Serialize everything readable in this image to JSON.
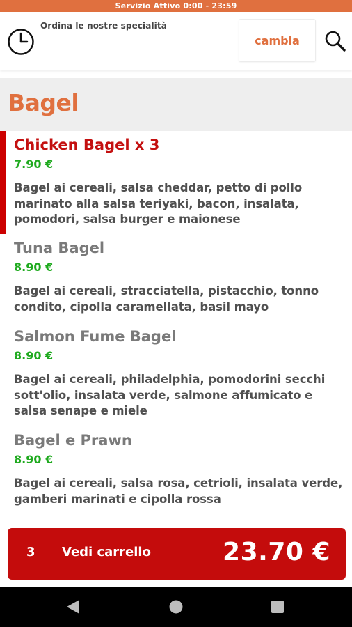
{
  "status_bar": {
    "text": "Servizio Attivo  0:00 - 23:59"
  },
  "header": {
    "order_text": "Ordina le nostre specialità",
    "change_label": "cambia"
  },
  "section": {
    "title": "Bagel"
  },
  "products": [
    {
      "name": "Chicken Bagel x 3",
      "price": "7.90 €",
      "description": "Bagel ai cereali, salsa cheddar, petto di pollo marinato alla salsa teriyaki, bacon, insalata, pomodori, salsa burger e maionese"
    },
    {
      "name": "Tuna Bagel",
      "price": "8.90 €",
      "description": "Bagel ai cereali, stracciatella, pistacchio, tonno condito, cipolla caramellata, basil mayo"
    },
    {
      "name": "Salmon Fume Bagel",
      "price": "8.90 €",
      "description": "Bagel ai cereali, philadelphia, pomodorini secchi sott'olio, insalata verde, salmone affumicato e salsa senape e miele"
    },
    {
      "name": "Bagel e Prawn",
      "price": "8.90 €",
      "description": "Bagel ai cereali, salsa rosa, cetrioli, insalata verde, gamberi marinati e cipolla rossa"
    }
  ],
  "cart": {
    "count": "3",
    "label": "Vedi carrello",
    "total": "23.70 €"
  },
  "colors": {
    "accent_orange": "#e0703f",
    "cart_red": "#c40c0c",
    "selected_red": "#c41010",
    "price_green": "#1faa1f"
  },
  "icons": {
    "clock": "clock-icon",
    "search": "search-icon",
    "back": "back-triangle-icon",
    "home": "home-circle-icon",
    "recent": "recent-square-icon"
  }
}
